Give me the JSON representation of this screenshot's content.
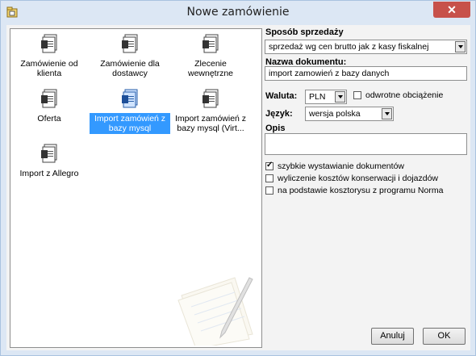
{
  "window": {
    "title": "Nowe zamówienie",
    "close_glyph": "✕"
  },
  "tiles": [
    {
      "label": "Zamówienie od klienta",
      "selected": false
    },
    {
      "label": "Zamówienie dla dostawcy",
      "selected": false
    },
    {
      "label": "Zlecenie wewnętrzne",
      "selected": false
    },
    {
      "label": "Oferta",
      "selected": false
    },
    {
      "label": "Import zamówień z bazy mysql",
      "selected": true
    },
    {
      "label": "Import zamówień z bazy mysql (Virt...",
      "selected": false
    },
    {
      "label": "Import z Allegro",
      "selected": false
    }
  ],
  "form": {
    "sale_method_label": "Sposób sprzedaży",
    "sale_method_value": "sprzedaż wg cen brutto jak z kasy fiskalnej",
    "doc_name_label": "Nazwa dokumentu:",
    "doc_name_value": "import zamowień z bazy danych",
    "currency_label": "Waluta:",
    "currency_value": "PLN",
    "reverse_charge_label": "odwrotne obciążenie",
    "reverse_charge_checked": false,
    "language_label": "Język:",
    "language_value": "wersja polska",
    "description_label": "Opis",
    "description_value": "",
    "options": [
      {
        "label": "szybkie wystawianie dokumentów",
        "checked": true
      },
      {
        "label": "wyliczenie kosztów konserwacji i dojazdów",
        "checked": false
      },
      {
        "label": "na podstawie kosztorysu z programu Norma",
        "checked": false
      }
    ]
  },
  "buttons": {
    "cancel": "Anuluj",
    "ok": "OK"
  },
  "colors": {
    "selection": "#3399ff",
    "close": "#c7514a",
    "frame": "#dce7f4"
  }
}
